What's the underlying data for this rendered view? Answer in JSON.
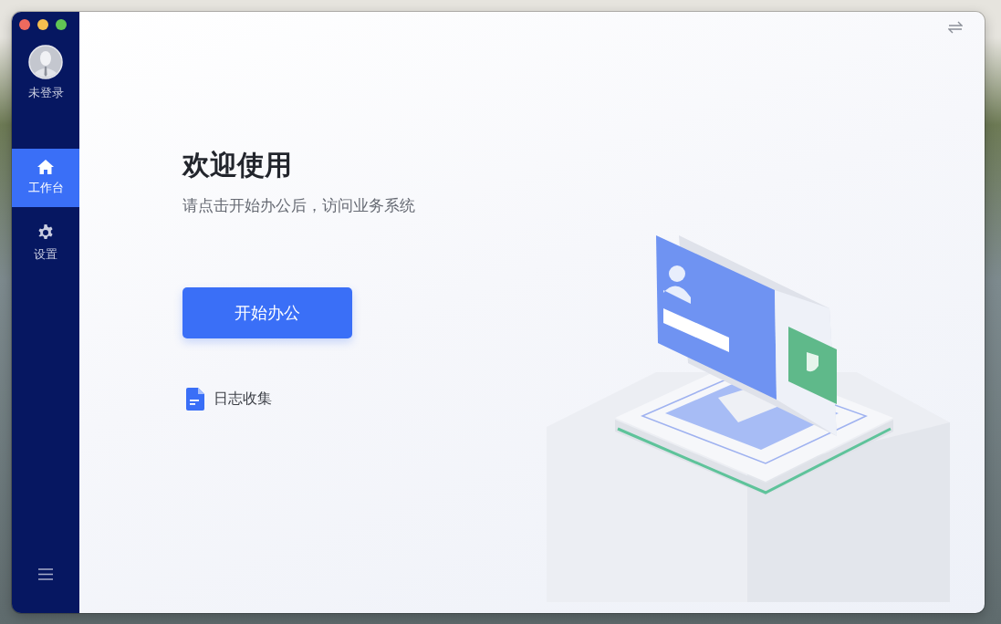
{
  "sidebar": {
    "user": {
      "label": "未登录"
    },
    "items": [
      {
        "label": "工作台",
        "kind": "home",
        "selected": true
      },
      {
        "label": "设置",
        "kind": "settings",
        "selected": false
      }
    ]
  },
  "main": {
    "title": "欢迎使用",
    "subtitle": "请点击开始办公后，访问业务系统",
    "start_button": "开始办公",
    "log_link": "日志收集"
  }
}
